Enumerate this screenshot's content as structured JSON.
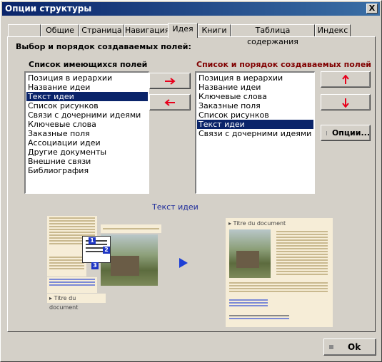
{
  "window": {
    "title": "Опции структуры",
    "close": "X"
  },
  "tabs": [
    {
      "label": ""
    },
    {
      "label": "Общие"
    },
    {
      "label": "Страница"
    },
    {
      "label": "Навигация"
    },
    {
      "label": "Идея"
    },
    {
      "label": "Книги"
    },
    {
      "label": "Таблица содержания"
    },
    {
      "label": "Индекс"
    }
  ],
  "main": {
    "section_title": "Выбор и порядок создаваемых полей:",
    "available_label": "Список имеющихся полей",
    "chosen_label": "Список и порядок создаваемых полей",
    "chosen_label_color": "#800000",
    "available_items": [
      "Позиция в иерархии",
      "Название идеи",
      "Текст идеи",
      "Список рисунков",
      "Связи с дочерними идеями",
      "Ключевые слова",
      "Заказные поля",
      "Ассоциации идеи",
      "Другие документы",
      "Внешние связи",
      "Библиография"
    ],
    "available_selected": "Текст идеи",
    "chosen_items": [
      "Позиция в иерархии",
      "Название идеи",
      "Ключевые слова",
      "Заказные поля",
      "Список рисунков",
      "Текст идеи",
      "Связи с дочерними идеями"
    ],
    "chosen_selected": "Текст идеи",
    "options_button": "Опции...",
    "preview_label": "Текст идеи",
    "preview_doc_title": "Titre du document",
    "badges": [
      "1",
      "2",
      "3"
    ]
  },
  "footer": {
    "ok_label": "Ok"
  },
  "colors": {
    "arrow": "#e8001c",
    "selection": "#0a246a",
    "preview_arrow": "#1d3fd6"
  }
}
